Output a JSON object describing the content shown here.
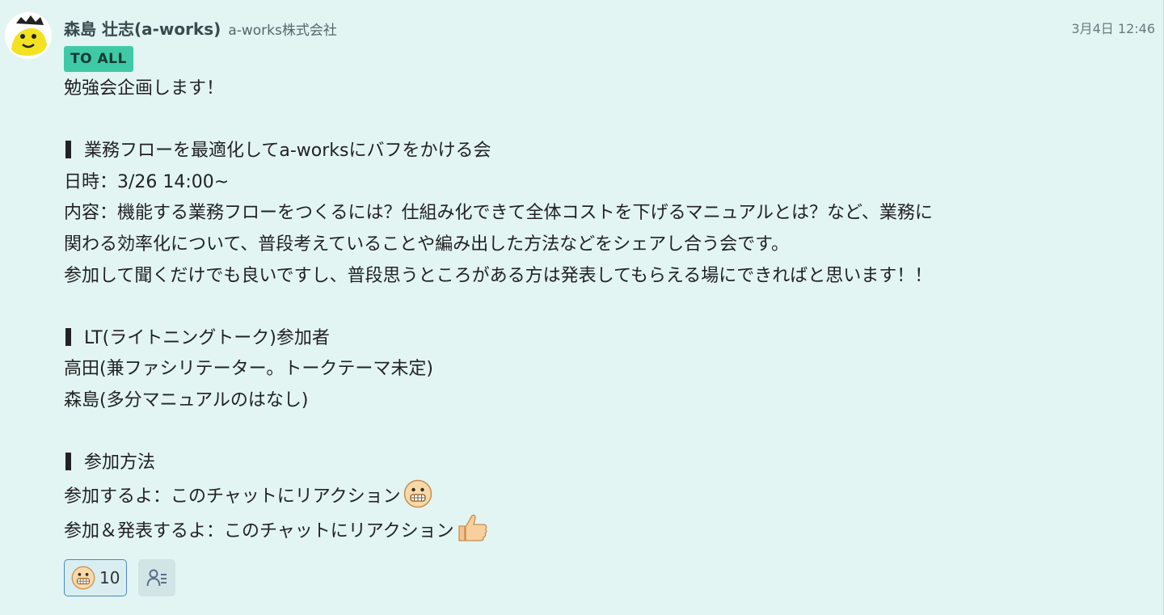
{
  "message": {
    "sender_name": "森島 壮志(a-works)",
    "sender_org": "a-works株式会社",
    "timestamp": "3月4日 12:46",
    "badge": "TO ALL",
    "lines": [
      "勉強会企画します！",
      "",
      "業務フローを最適化してa-worksにバフをかける会",
      "日時：3/26 14:00~",
      "内容：機能する業務フローをつくるには？仕組み化できて全体コストを下げるマニュアルとは？など、業務に",
      "関わる効率化について、普段考えていることや編み出した方法などをシェアし合う会です。",
      "参加して聞くだけでも良いですし、普段思うところがある方は発表してもらえる場にできればと思います！！",
      "",
      "LT(ライトニングトーク)参加者",
      "高田(兼ファシリテーター。トークテーマ未定)",
      "森島(多分マニュアルのはなし)",
      "",
      "参加方法",
      "参加するよ：このチャットにリアクション",
      "参加＆発表するよ：このチャットにリアクション"
    ],
    "line_icons": {
      "13": "grimacing-face-emoji",
      "14": "thumbs-up-emoji"
    }
  },
  "reactions": [
    {
      "icon": "grimacing-face-emoji",
      "count": "10"
    }
  ],
  "colors": {
    "background": "#e2f5f3",
    "badge_bg": "#40c9a6",
    "reaction_border": "#4d87c4"
  }
}
